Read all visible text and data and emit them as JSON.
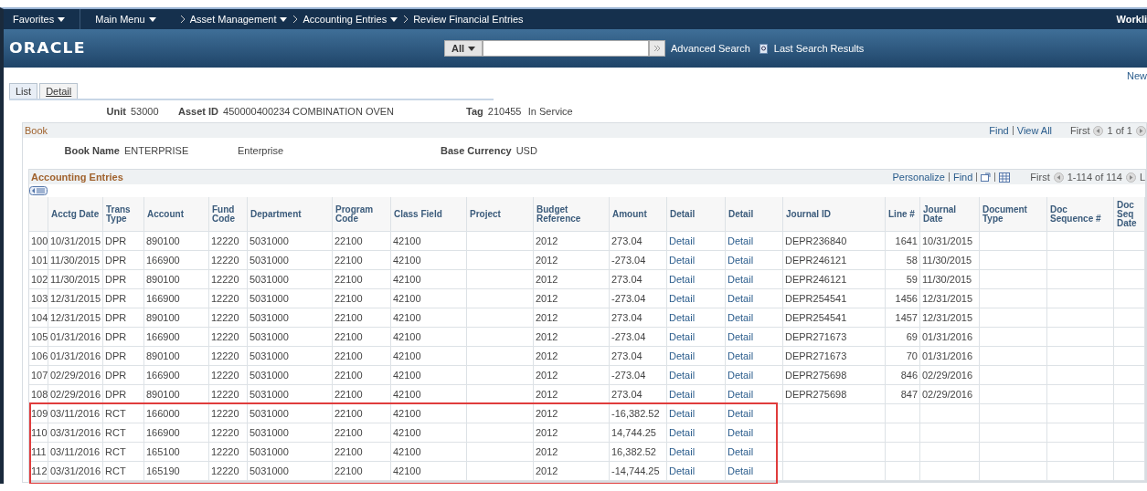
{
  "nav": {
    "items": [
      {
        "label": "Favorites",
        "kind": "menu"
      },
      {
        "label": "Main Menu",
        "kind": "menu"
      },
      {
        "label": "Asset Management",
        "kind": "crumb-menu"
      },
      {
        "label": "Accounting Entries",
        "kind": "crumb-menu"
      },
      {
        "label": "Review Financial Entries",
        "kind": "crumb"
      }
    ],
    "right_link": "Workli"
  },
  "search": {
    "logo": "ORACLE",
    "scope": "All",
    "advanced": "Advanced Search",
    "last_results": "Last Search Results"
  },
  "new_window_link": "New",
  "tabs": [
    {
      "label": "List",
      "selected": true
    },
    {
      "label": "Detail",
      "selected": false
    }
  ],
  "asset": {
    "unit_label": "Unit",
    "unit": "53000",
    "asset_id_label": "Asset ID",
    "asset_id": "450000400234",
    "description": "COMBINATION OVEN",
    "tag_label": "Tag",
    "tag": "210455",
    "status": "In Service"
  },
  "book": {
    "title": "Book",
    "find": "Find",
    "view_all": "View All",
    "first": "First",
    "count": "1 of 1",
    "name_label": "Book Name",
    "name": "ENTERPRISE",
    "name_desc": "Enterprise",
    "currency_label": "Base Currency",
    "currency": "USD"
  },
  "entries": {
    "title": "Accounting Entries",
    "personalize": "Personalize",
    "find": "Find",
    "first": "First",
    "count": "1-114 of 114",
    "last": "L",
    "columns": [
      "Acctg Date",
      "Trans Type",
      "Account",
      "Fund Code",
      "Department",
      "Program Code",
      "Class Field",
      "Project",
      "Budget Reference",
      "Amount",
      "Detail",
      "Detail",
      "Journal ID",
      "Line #",
      "Journal Date",
      "Document Type",
      "Doc Sequence #",
      "Doc Seq Date"
    ],
    "rows": [
      {
        "no": "100",
        "acctg_date": "10/31/2015",
        "trans_type": "DPR",
        "account": "890100",
        "fund_code": "12220",
        "department": "5031000",
        "program_code": "22100",
        "class_field": "42100",
        "budget_reference": "2012",
        "amount": "273.04",
        "detail_1": "Detail",
        "detail_2": "Detail",
        "journal_id": "DEPR236840",
        "line": "1641",
        "journal_date": "10/31/2015",
        "highlighted": false
      },
      {
        "no": "101",
        "acctg_date": "11/30/2015",
        "trans_type": "DPR",
        "account": "166900",
        "fund_code": "12220",
        "department": "5031000",
        "program_code": "22100",
        "class_field": "42100",
        "budget_reference": "2012",
        "amount": "-273.04",
        "detail_1": "Detail",
        "detail_2": "Detail",
        "journal_id": "DEPR246121",
        "line": "58",
        "journal_date": "11/30/2015",
        "highlighted": false
      },
      {
        "no": "102",
        "acctg_date": "11/30/2015",
        "trans_type": "DPR",
        "account": "890100",
        "fund_code": "12220",
        "department": "5031000",
        "program_code": "22100",
        "class_field": "42100",
        "budget_reference": "2012",
        "amount": "273.04",
        "detail_1": "Detail",
        "detail_2": "Detail",
        "journal_id": "DEPR246121",
        "line": "59",
        "journal_date": "11/30/2015",
        "highlighted": false
      },
      {
        "no": "103",
        "acctg_date": "12/31/2015",
        "trans_type": "DPR",
        "account": "166900",
        "fund_code": "12220",
        "department": "5031000",
        "program_code": "22100",
        "class_field": "42100",
        "budget_reference": "2012",
        "amount": "-273.04",
        "detail_1": "Detail",
        "detail_2": "Detail",
        "journal_id": "DEPR254541",
        "line": "1456",
        "journal_date": "12/31/2015",
        "highlighted": false
      },
      {
        "no": "104",
        "acctg_date": "12/31/2015",
        "trans_type": "DPR",
        "account": "890100",
        "fund_code": "12220",
        "department": "5031000",
        "program_code": "22100",
        "class_field": "42100",
        "budget_reference": "2012",
        "amount": "273.04",
        "detail_1": "Detail",
        "detail_2": "Detail",
        "journal_id": "DEPR254541",
        "line": "1457",
        "journal_date": "12/31/2015",
        "highlighted": false
      },
      {
        "no": "105",
        "acctg_date": "01/31/2016",
        "trans_type": "DPR",
        "account": "166900",
        "fund_code": "12220",
        "department": "5031000",
        "program_code": "22100",
        "class_field": "42100",
        "budget_reference": "2012",
        "amount": "-273.04",
        "detail_1": "Detail",
        "detail_2": "Detail",
        "journal_id": "DEPR271673",
        "line": "69",
        "journal_date": "01/31/2016",
        "highlighted": false
      },
      {
        "no": "106",
        "acctg_date": "01/31/2016",
        "trans_type": "DPR",
        "account": "890100",
        "fund_code": "12220",
        "department": "5031000",
        "program_code": "22100",
        "class_field": "42100",
        "budget_reference": "2012",
        "amount": "273.04",
        "detail_1": "Detail",
        "detail_2": "Detail",
        "journal_id": "DEPR271673",
        "line": "70",
        "journal_date": "01/31/2016",
        "highlighted": false
      },
      {
        "no": "107",
        "acctg_date": "02/29/2016",
        "trans_type": "DPR",
        "account": "166900",
        "fund_code": "12220",
        "department": "5031000",
        "program_code": "22100",
        "class_field": "42100",
        "budget_reference": "2012",
        "amount": "-273.04",
        "detail_1": "Detail",
        "detail_2": "Detail",
        "journal_id": "DEPR275698",
        "line": "846",
        "journal_date": "02/29/2016",
        "highlighted": false
      },
      {
        "no": "108",
        "acctg_date": "02/29/2016",
        "trans_type": "DPR",
        "account": "890100",
        "fund_code": "12220",
        "department": "5031000",
        "program_code": "22100",
        "class_field": "42100",
        "budget_reference": "2012",
        "amount": "273.04",
        "detail_1": "Detail",
        "detail_2": "Detail",
        "journal_id": "DEPR275698",
        "line": "847",
        "journal_date": "02/29/2016",
        "highlighted": false
      },
      {
        "no": "109",
        "acctg_date": "03/11/2016",
        "trans_type": "RCT",
        "account": "166000",
        "fund_code": "12220",
        "department": "5031000",
        "program_code": "22100",
        "class_field": "42100",
        "budget_reference": "2012",
        "amount": "-16,382.52",
        "detail_1": "Detail",
        "detail_2": "Detail",
        "highlighted": true
      },
      {
        "no": "110",
        "acctg_date": "03/31/2016",
        "trans_type": "RCT",
        "account": "166900",
        "fund_code": "12220",
        "department": "5031000",
        "program_code": "22100",
        "class_field": "42100",
        "budget_reference": "2012",
        "amount": "14,744.25",
        "detail_1": "Detail",
        "detail_2": "Detail",
        "highlighted": true
      },
      {
        "no": "111",
        "acctg_date": "03/11/2016",
        "trans_type": "RCT",
        "account": "165100",
        "fund_code": "12220",
        "department": "5031000",
        "program_code": "22100",
        "class_field": "42100",
        "budget_reference": "2012",
        "amount": "16,382.52",
        "detail_1": "Detail",
        "detail_2": "Detail",
        "highlighted": true
      },
      {
        "no": "112",
        "acctg_date": "03/31/2016",
        "trans_type": "RCT",
        "account": "165190",
        "fund_code": "12220",
        "department": "5031000",
        "program_code": "22100",
        "class_field": "42100",
        "budget_reference": "2012",
        "amount": "-14,744.25",
        "detail_1": "Detail",
        "detail_2": "Detail",
        "highlighted": true
      }
    ]
  }
}
